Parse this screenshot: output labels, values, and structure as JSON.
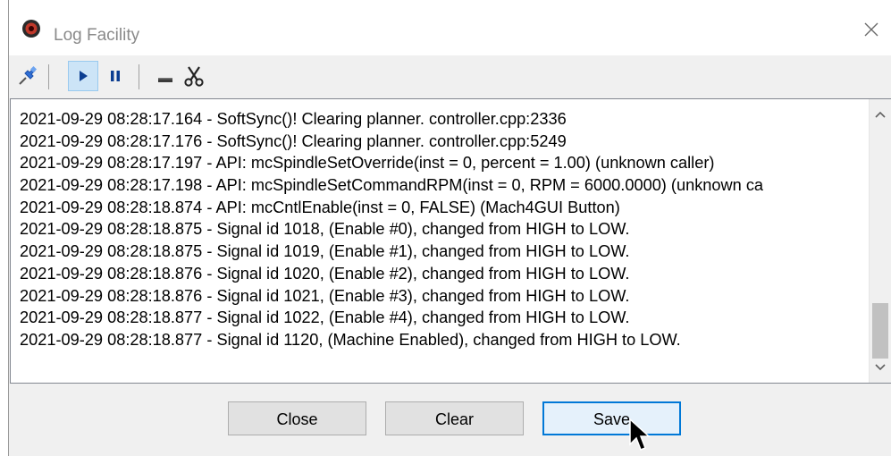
{
  "window": {
    "title": "Log Facility",
    "icon": "mach4-app-icon",
    "close_icon": "close-icon"
  },
  "toolbar": {
    "items": [
      {
        "icon": "pin-icon"
      },
      {
        "icon": "play-icon",
        "active": true
      },
      {
        "icon": "pause-icon"
      },
      {
        "icon": "minus-icon"
      },
      {
        "icon": "scissors-icon"
      }
    ]
  },
  "log": {
    "lines": [
      "2021-09-29 08:28:17.164 - SoftSync()! Clearing planner. controller.cpp:2336",
      "2021-09-29 08:28:17.176 - SoftSync()! Clearing planner. controller.cpp:5249",
      "2021-09-29 08:28:17.197 - API: mcSpindleSetOverride(inst = 0, percent = 1.00) (unknown caller)",
      "2021-09-29 08:28:17.198 - API: mcSpindleSetCommandRPM(inst = 0, RPM = 6000.0000) (unknown ca",
      "2021-09-29 08:28:18.874 - API: mcCntlEnable(inst = 0, FALSE) (Mach4GUI Button)",
      "2021-09-29 08:28:18.875 - Signal id 1018, (Enable #0), changed from HIGH to LOW.",
      "2021-09-29 08:28:18.875 - Signal id 1019, (Enable #1), changed from HIGH to LOW.",
      "2021-09-29 08:28:18.876 - Signal id 1020, (Enable #2), changed from HIGH to LOW.",
      "2021-09-29 08:28:18.876 - Signal id 1021, (Enable #3), changed from HIGH to LOW.",
      "2021-09-29 08:28:18.877 - Signal id 1022, (Enable #4), changed from HIGH to LOW.",
      "2021-09-29 08:28:18.877 - Signal id 1120, (Machine Enabled), changed from HIGH to LOW."
    ]
  },
  "buttons": {
    "close_label": "Close",
    "clear_label": "Clear",
    "save_label": "Save"
  },
  "colors": {
    "accent": "#0078d7",
    "active_tool_bg": "#cce4f7"
  }
}
